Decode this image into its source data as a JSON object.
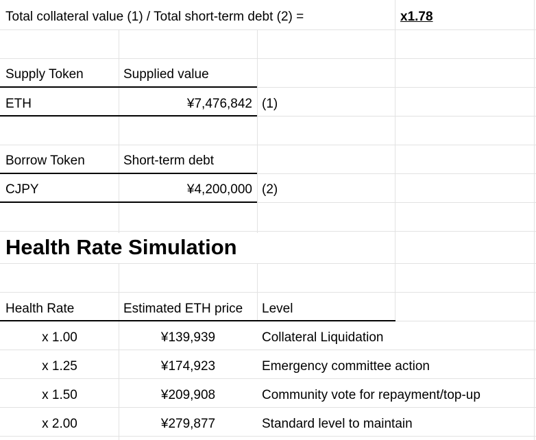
{
  "summary": {
    "formula_label": "Total collateral value (1) / Total short-term debt (2) =",
    "ratio": "x1.78"
  },
  "supply": {
    "header_token": "Supply Token",
    "header_value": "Supplied value",
    "token": "ETH",
    "value": "¥7,476,842",
    "marker": "(1)"
  },
  "borrow": {
    "header_token": "Borrow Token",
    "header_value": "Short-term debt",
    "token": "CJPY",
    "value": "¥4,200,000",
    "marker": "(2)"
  },
  "simulation": {
    "title": "Health Rate Simulation",
    "headers": [
      "Health Rate",
      "Estimated ETH price",
      "Level"
    ],
    "rows": [
      {
        "rate": "x 1.00",
        "price": "¥139,939",
        "level": "Collateral Liquidation"
      },
      {
        "rate": "x 1.25",
        "price": "¥174,923",
        "level": "Emergency committee action"
      },
      {
        "rate": "x 1.50",
        "price": "¥209,908",
        "level": "Community vote for repayment/top-up"
      },
      {
        "rate": "x 2.00",
        "price": "¥279,877",
        "level": "Standard level to maintain"
      }
    ]
  }
}
